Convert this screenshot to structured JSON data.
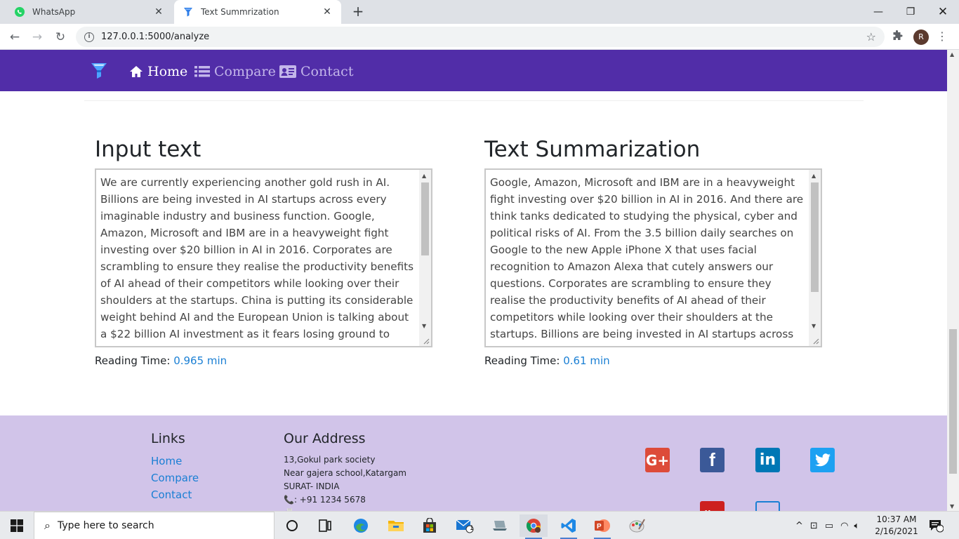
{
  "browser": {
    "tabs": [
      {
        "title": "WhatsApp",
        "active": false,
        "icon": "whatsapp-icon"
      },
      {
        "title": "Text Summrization",
        "active": true,
        "icon": "funnel-icon"
      }
    ],
    "url": "127.0.0.1:5000/analyze",
    "profile_initial": "R"
  },
  "nav": {
    "home": "Home",
    "compare": "Compare",
    "contact": "Contact"
  },
  "input_col": {
    "heading": "Input text",
    "text": "We are currently experiencing another gold rush in AI. Billions are being invested in AI startups across every imaginable industry and business function. Google, Amazon, Microsoft and IBM are in a heavyweight fight investing over $20 billion in AI in 2016. Corporates are scrambling to ensure they realise the productivity benefits of AI ahead of their competitors while looking over their shoulders at the startups. China is putting its considerable weight behind AI and the European Union is talking about a $22 billion AI investment as it fears losing ground to China and the US.",
    "reading_label": "Reading Time: ",
    "reading_value": "0.965 min",
    "scroll_fraction": 0.42
  },
  "summary_col": {
    "heading": "Text Summarization",
    "text": "Google, Amazon, Microsoft and IBM are in a heavyweight fight investing over $20 billion in AI in 2016. And there are think tanks dedicated to studying the physical, cyber and political risks of AI. From the 3.5 billion daily searches on Google to the new Apple iPhone X that uses facial recognition to Amazon Alexa that cutely answers our questions. Corporates are scrambling to ensure they realise the productivity benefits of AI ahead of their competitors while looking over their shoulders at the startups. Billions are being invested in AI startups across every imaginable industry and business",
    "reading_label": "Reading Time: ",
    "reading_value": "0.61 min",
    "scroll_fraction": 0.66
  },
  "footer": {
    "links_heading": "Links",
    "links": [
      "Home",
      "Compare",
      "Contact"
    ],
    "address_heading": "Our Address",
    "address_lines": [
      "13,Gokul park society",
      "Near gajera school,Katargam",
      "SURAT- INDIA"
    ],
    "phone": ": +91 1234 5678",
    "social": [
      {
        "name": "google-plus",
        "label": "G+",
        "color": "#dd4b39"
      },
      {
        "name": "facebook",
        "label": "f",
        "color": "#3b5998"
      },
      {
        "name": "linkedin",
        "label": "in",
        "color": "#0077b5"
      },
      {
        "name": "twitter",
        "label": "t",
        "color": "#1da1f2"
      }
    ]
  },
  "taskbar": {
    "search_placeholder": "Type here to search",
    "time": "10:37 AM",
    "date": "2/16/2021",
    "notification_count": "4",
    "mail_badge": "1"
  },
  "colors": {
    "nav_bg": "#512da8",
    "footer_bg": "#d1c4e9",
    "link": "#1a7fd4"
  }
}
